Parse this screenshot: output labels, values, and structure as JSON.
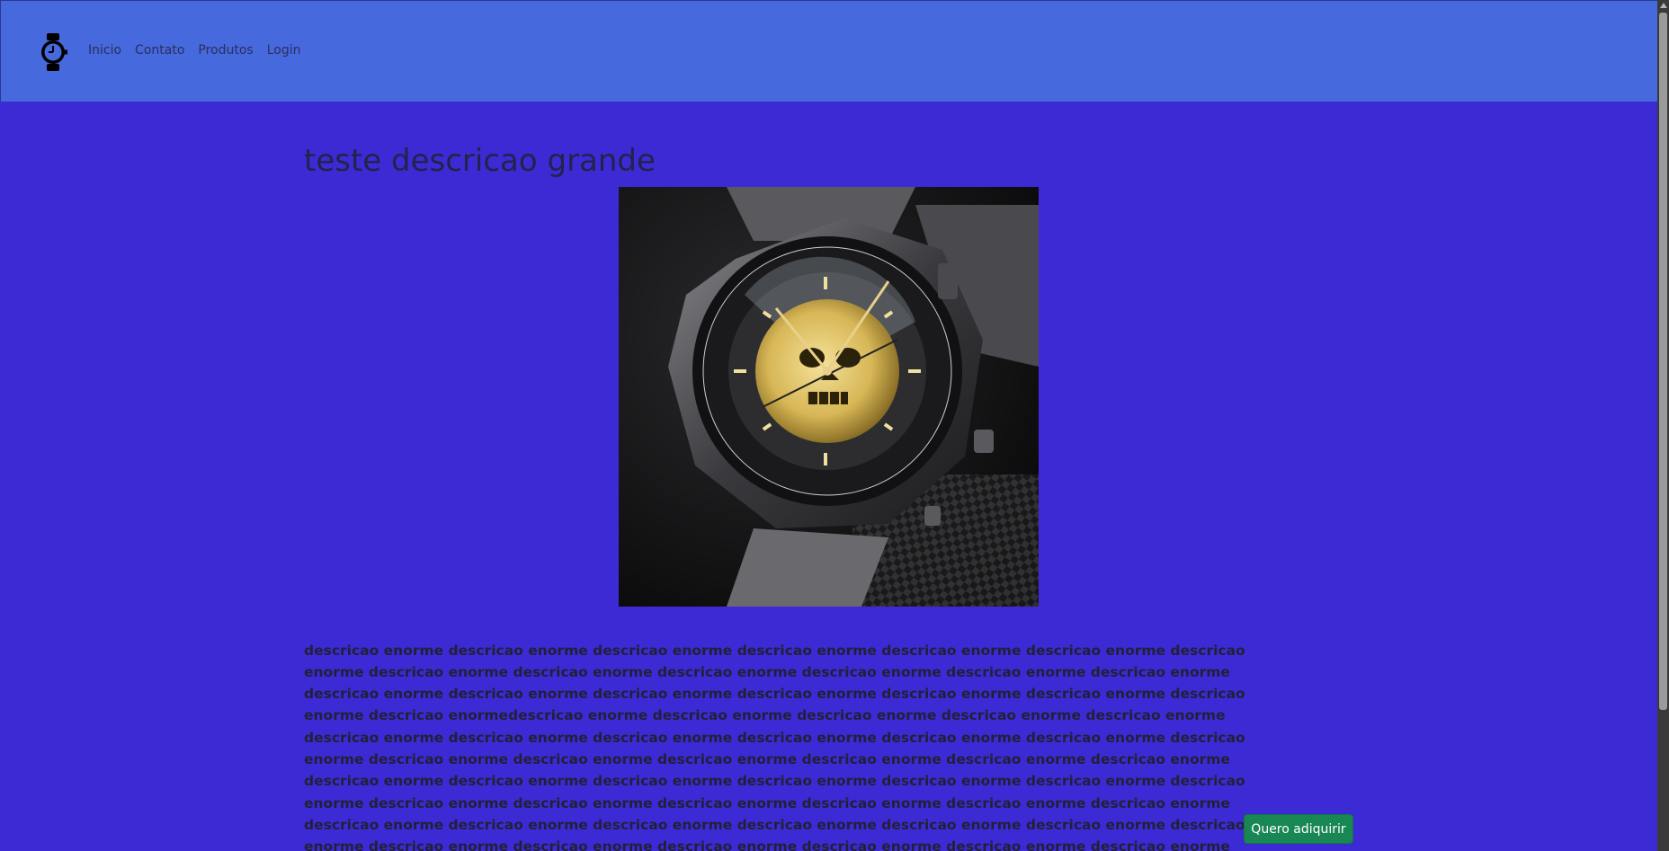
{
  "navbar": {
    "brand_icon": "wristwatch-icon",
    "links": [
      {
        "label": "Inicio"
      },
      {
        "label": "Contato"
      },
      {
        "label": "Produtos"
      },
      {
        "label": "Login"
      }
    ],
    "background": "#4769de"
  },
  "product": {
    "title": "teste descricao grande",
    "image_icon": "watch-photo",
    "description": "descricao enorme descricao enorme descricao enorme descricao enorme descricao enorme descricao enorme descricao enorme descricao enorme descricao enorme descricao enorme descricao enorme descricao enorme descricao enorme descricao enorme descricao enorme descricao enorme descricao enorme descricao enorme descricao enorme descricao enorme descricao enormedescricao enorme descricao enorme descricao enorme descricao enorme descricao enorme descricao enorme descricao enorme descricao enorme descricao enorme descricao enorme descricao enorme descricao enorme descricao enorme descricao enorme descricao enorme descricao enorme descricao enorme descricao enorme descricao enorme descricao enorme descricao enorme descricao enorme descricao enorme descricao enorme descricao enorme descricao enorme descricao enorme descricao enorme descricao enorme descricao enorme descricao enorme descricao enorme descricao enorme descricao enorme descricao enorme descricao enorme descricao enorme descricao enorme descricao enorme descricao enorme descricao enorme descricao enorme descricao enorme descricao enorme descricao enorme",
    "buy_label": "Quero adiquirir"
  },
  "colors": {
    "page_background": "#3c2bd4",
    "buy_button": "#198754"
  }
}
